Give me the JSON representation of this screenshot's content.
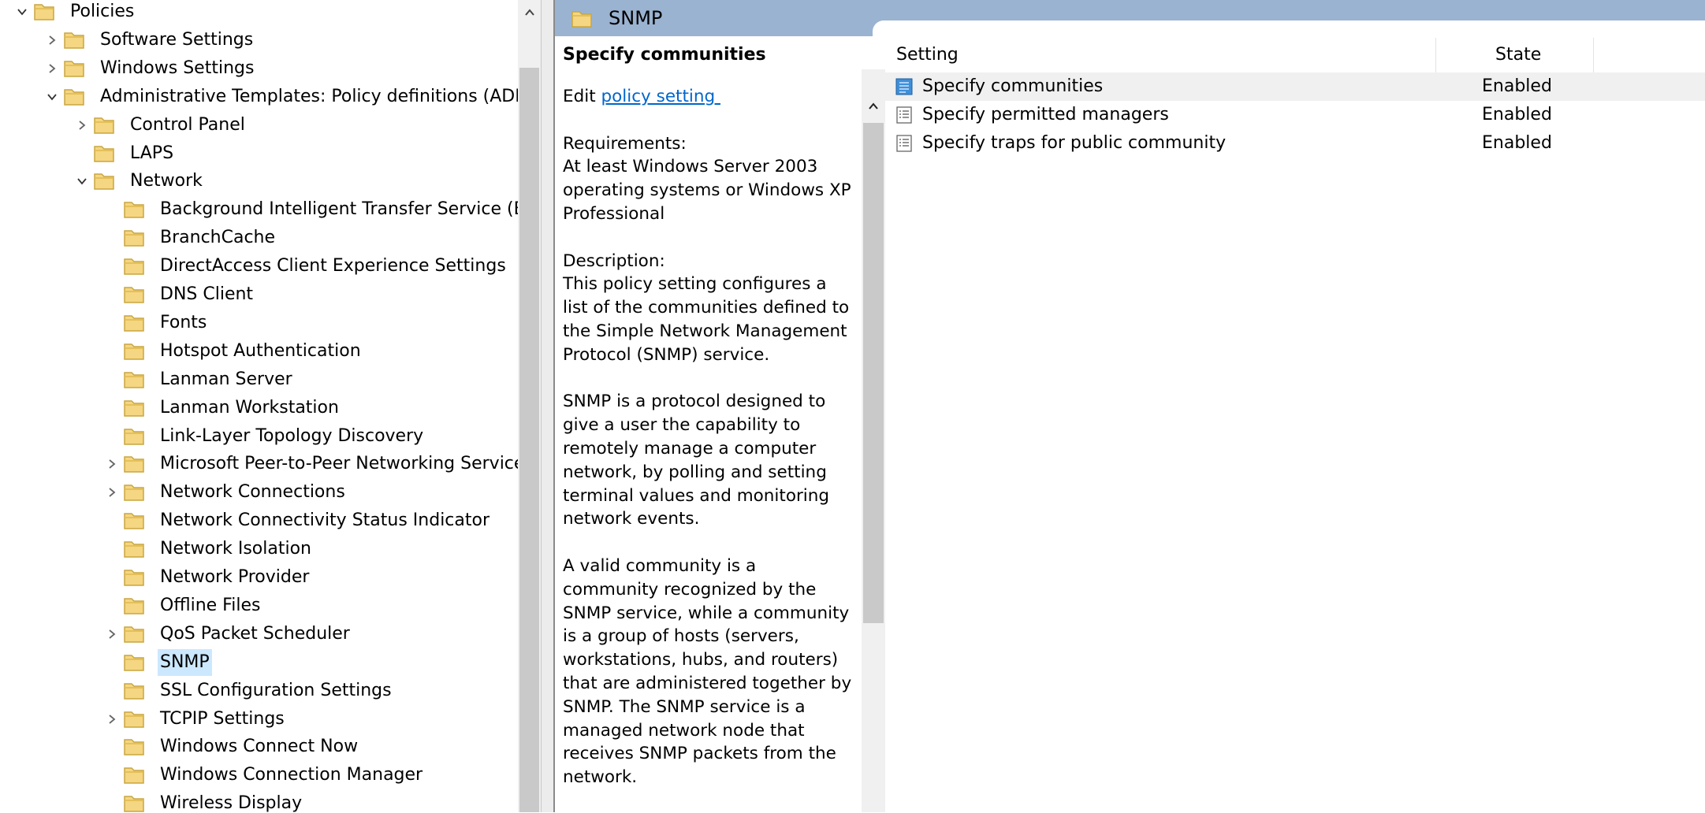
{
  "tree": {
    "items": [
      {
        "label": "Policies",
        "expander": "expanded",
        "level": 0
      },
      {
        "label": "Software Settings",
        "expander": "collapsed",
        "level": 1
      },
      {
        "label": "Windows Settings",
        "expander": "collapsed",
        "level": 1
      },
      {
        "label": "Administrative Templates: Policy definitions (ADM",
        "expander": "expanded",
        "level": 1
      },
      {
        "label": "Control Panel",
        "expander": "collapsed",
        "level": 2
      },
      {
        "label": "LAPS",
        "expander": "none",
        "level": 2
      },
      {
        "label": "Network",
        "expander": "expanded",
        "level": 2
      },
      {
        "label": "Background Intelligent Transfer Service (BIT",
        "expander": "none",
        "level": 3
      },
      {
        "label": "BranchCache",
        "expander": "none",
        "level": 3
      },
      {
        "label": "DirectAccess Client Experience Settings",
        "expander": "none",
        "level": 3
      },
      {
        "label": "DNS Client",
        "expander": "none",
        "level": 3
      },
      {
        "label": "Fonts",
        "expander": "none",
        "level": 3
      },
      {
        "label": "Hotspot Authentication",
        "expander": "none",
        "level": 3
      },
      {
        "label": "Lanman Server",
        "expander": "none",
        "level": 3
      },
      {
        "label": "Lanman Workstation",
        "expander": "none",
        "level": 3
      },
      {
        "label": "Link-Layer Topology Discovery",
        "expander": "none",
        "level": 3
      },
      {
        "label": "Microsoft Peer-to-Peer Networking Service",
        "expander": "collapsed",
        "level": 3
      },
      {
        "label": "Network Connections",
        "expander": "collapsed",
        "level": 3
      },
      {
        "label": "Network Connectivity Status Indicator",
        "expander": "none",
        "level": 3
      },
      {
        "label": "Network Isolation",
        "expander": "none",
        "level": 3
      },
      {
        "label": "Network Provider",
        "expander": "none",
        "level": 3
      },
      {
        "label": "Offline Files",
        "expander": "none",
        "level": 3
      },
      {
        "label": "QoS Packet Scheduler",
        "expander": "collapsed",
        "level": 3
      },
      {
        "label": "SNMP",
        "expander": "none",
        "level": 3,
        "selected": true
      },
      {
        "label": "SSL Configuration Settings",
        "expander": "none",
        "level": 3
      },
      {
        "label": "TCPIP Settings",
        "expander": "collapsed",
        "level": 3
      },
      {
        "label": "Windows Connect Now",
        "expander": "none",
        "level": 3
      },
      {
        "label": "Windows Connection Manager",
        "expander": "none",
        "level": 3
      },
      {
        "label": "Wireless Display",
        "expander": "none",
        "level": 3
      }
    ]
  },
  "header": {
    "title": "SNMP"
  },
  "description": {
    "title": "Specify communities",
    "edit_prefix": "Edit ",
    "edit_link": "policy setting ",
    "requirements": "Requirements:\nAt least Windows Server 2003 operating systems or Windows XP Professional",
    "description": "Description:\nThis policy setting configures a list of the communities defined to the Simple Network Management Protocol (SNMP) service.",
    "snmp_para": "SNMP is a protocol designed to give a user the capability to remotely manage a computer network, by polling and setting terminal values and monitoring network events.",
    "community_para": "A valid community is a community recognized by the SNMP service, while a community is a group of hosts (servers, workstations, hubs, and routers) that are administered together by SNMP. The SNMP service is a managed network node that receives SNMP packets from the network."
  },
  "settings_list": {
    "columns": {
      "setting": "Setting",
      "state": "State"
    },
    "rows": [
      {
        "name": "Specify communities",
        "state": "Enabled",
        "icon": "policy-setting-selected-icon",
        "selected": true
      },
      {
        "name": "Specify permitted managers",
        "state": "Enabled",
        "icon": "policy-setting-icon"
      },
      {
        "name": "Specify traps for public community",
        "state": "Enabled",
        "icon": "policy-setting-icon"
      }
    ]
  },
  "colors": {
    "header_bar": "#9ab3d1",
    "tree_selection": "#cce8ff",
    "link": "#0066cc",
    "folder": "#f5d682"
  }
}
